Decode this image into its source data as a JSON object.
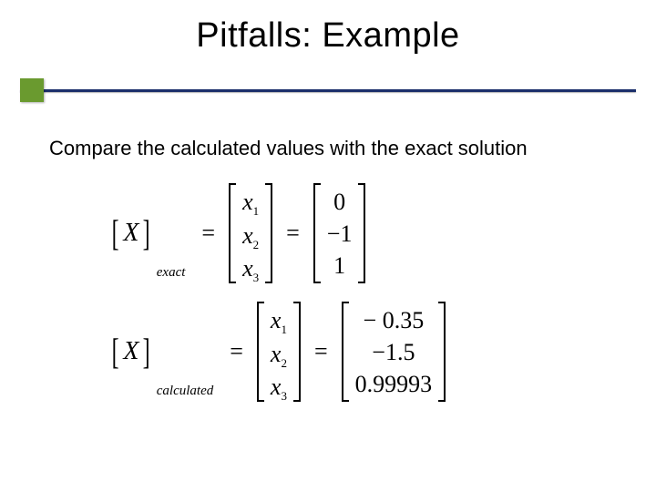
{
  "title": "Pitfalls: Example",
  "body": "Compare the calculated values with the exact solution",
  "eq1": {
    "lhs_var": "X",
    "lhs_sub": "exact",
    "vec_labels": {
      "x1": "x",
      "s1": "1",
      "x2": "x",
      "s2": "2",
      "x3": "x",
      "s3": "3"
    },
    "vals": {
      "v1": "0",
      "v2": "−1",
      "v3": "1"
    }
  },
  "eq2": {
    "lhs_var": "X",
    "lhs_sub": "calculated",
    "vec_labels": {
      "x1": "x",
      "s1": "1",
      "x2": "x",
      "s2": "2",
      "x3": "x",
      "s3": "3"
    },
    "vals": {
      "v1": "− 0.35",
      "v2": "−1.5",
      "v3": "0.99993"
    }
  }
}
